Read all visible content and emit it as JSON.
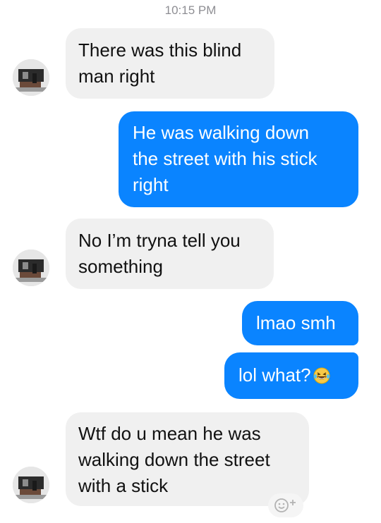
{
  "status": {
    "time": "10:15 PM"
  },
  "messages": [
    {
      "direction": "incoming",
      "text": "There was this blind\nman right"
    },
    {
      "direction": "outgoing",
      "text": "He was walking down\nthe street with his stick\nright"
    },
    {
      "direction": "incoming",
      "text": "No I’m tryna tell you\nsomething"
    },
    {
      "direction": "outgoing",
      "text": "lmao smh"
    },
    {
      "direction": "outgoing",
      "text": "lol what?",
      "emoji": "tears-of-joy-emoji"
    },
    {
      "direction": "incoming",
      "text": "Wtf do u mean he was\nwalking down the street\nwith a stick"
    }
  ],
  "icons": {
    "reaction": "add-reaction-icon"
  },
  "colors": {
    "outgoing_bubble": "#0a84ff",
    "incoming_bubble": "#f0f0f0",
    "timestamp": "#8e8e93"
  }
}
